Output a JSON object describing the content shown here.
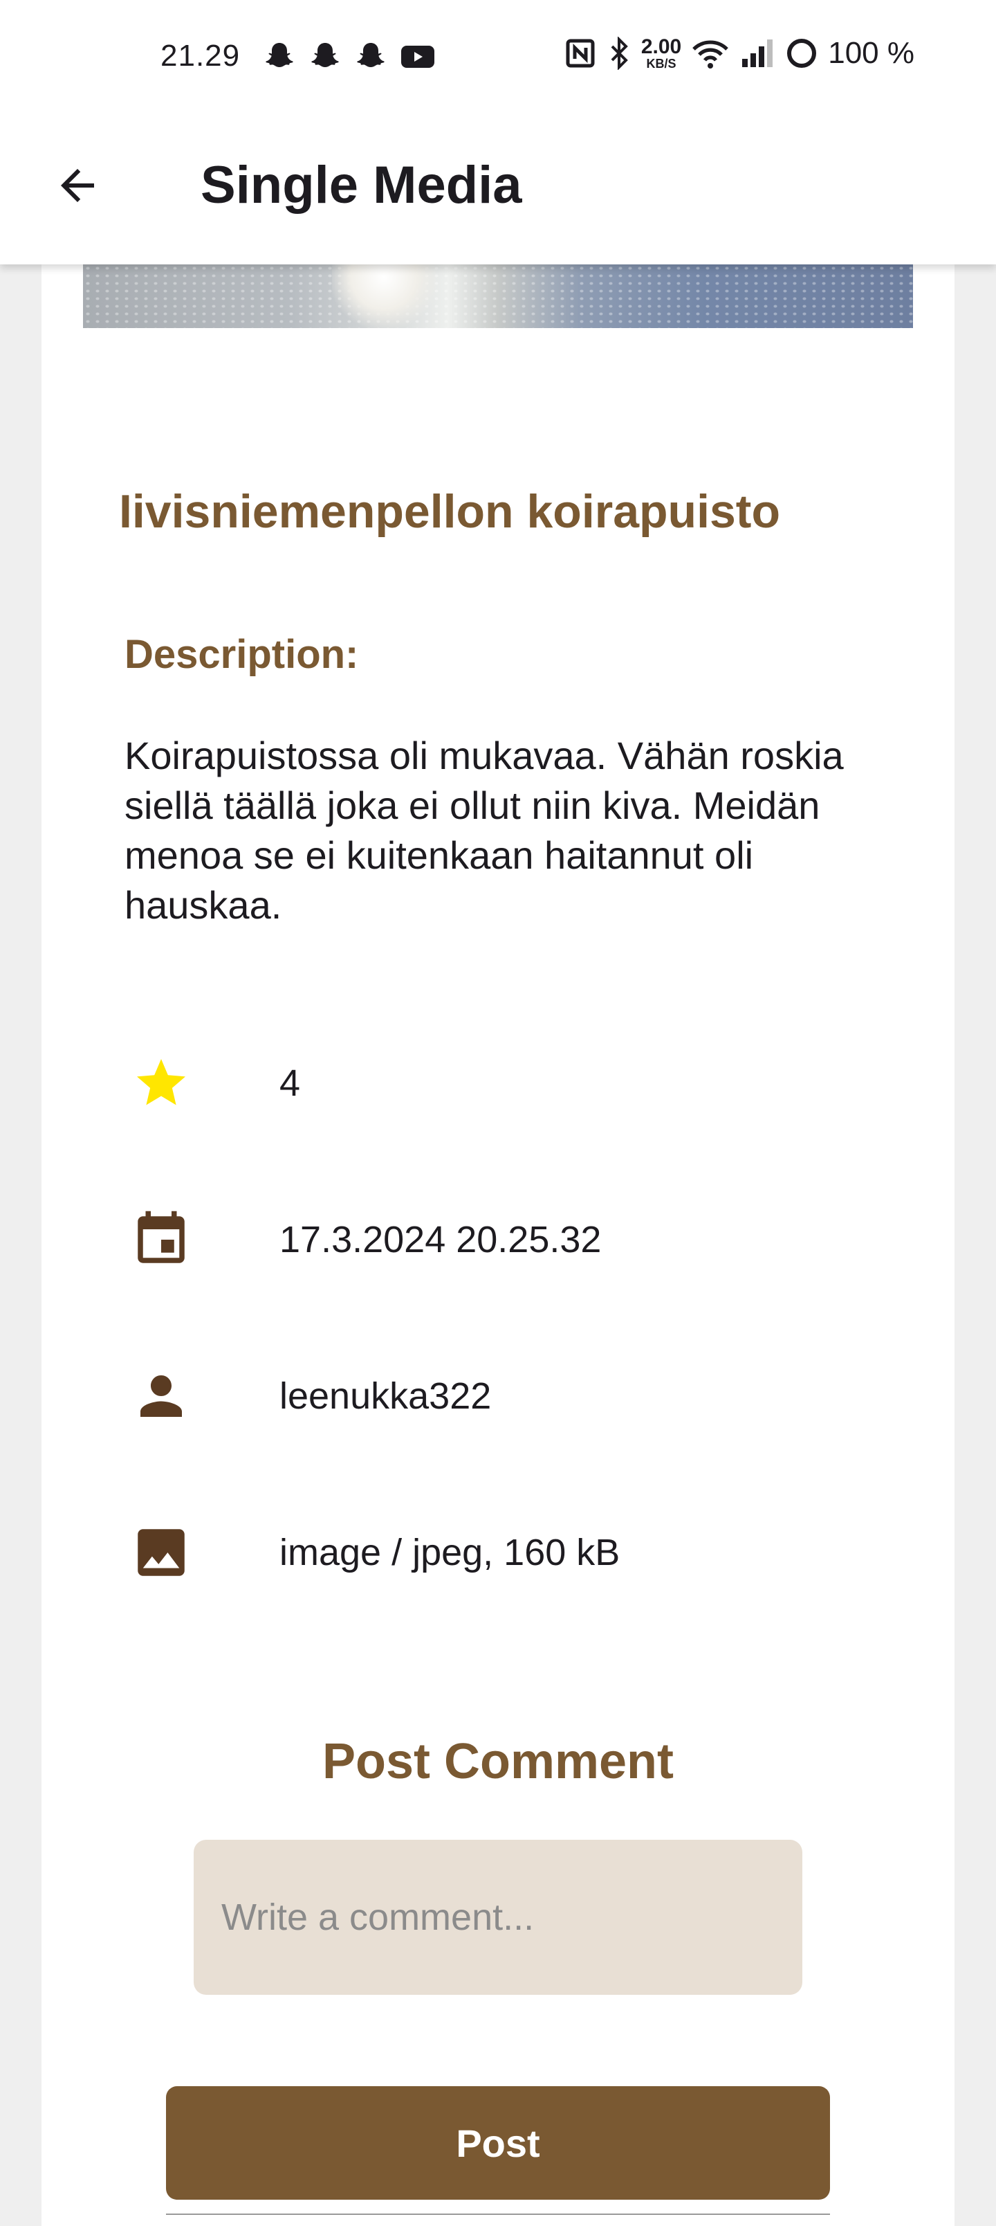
{
  "status_bar": {
    "time": "21.29",
    "net_speed_value": "2.00",
    "net_speed_unit": "KB/S",
    "battery": "100 %",
    "left_icons": [
      "snapchat-icon",
      "snapchat-icon",
      "snapchat-icon",
      "youtube-icon"
    ],
    "right_icons": [
      "nfc-icon",
      "bluetooth-icon",
      "wifi-icon",
      "signal-icon",
      "battery-icon"
    ]
  },
  "app_bar": {
    "title": "Single Media",
    "back_icon": "arrow-back-icon"
  },
  "media": {
    "title": "Iivisniemenpellon koirapuisto",
    "description_label": "Description:",
    "description": "Koirapuistossa oli mukavaa. Vähän roskia siellä täällä joka ei ollut niin kiva. Meidän menoa se ei kuitenkaan haitannut oli hauskaa.",
    "rating": "4",
    "date": "17.3.2024 20.25.32",
    "username": "leenukka322",
    "file_info": "image / jpeg, 160 kB"
  },
  "comment": {
    "heading": "Post Comment",
    "placeholder": "Write a comment...",
    "button_label": "Post"
  },
  "colors": {
    "accent": "#7a5932",
    "icon": "#5a3b22",
    "star": "#ffe600",
    "input_bg": "#e8dfd4"
  }
}
